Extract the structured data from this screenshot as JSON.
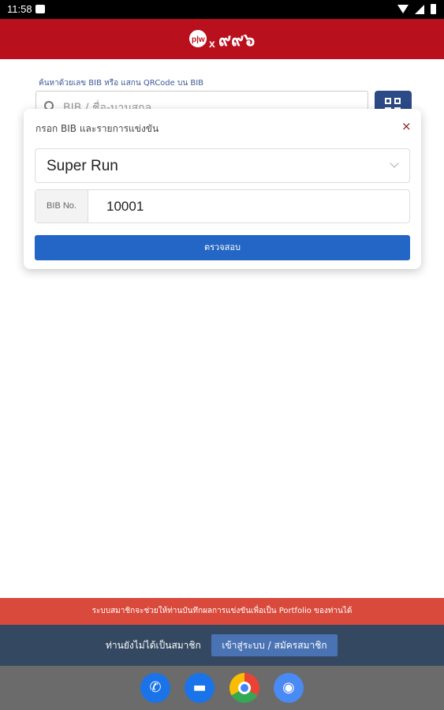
{
  "status_bar": {
    "time": "11:58"
  },
  "search": {
    "hint": "ค้นหาด้วยเลข BIB หรือ แสกน QRCode บน BIB",
    "placeholder": "BIB / ชื่อ-นามสกุล"
  },
  "modal": {
    "title": "กรอก BIB และรายการแข่งขัน",
    "close_label": "×",
    "race_selected": "Super Run",
    "bib_label": "BIB No.",
    "bib_value": "10001",
    "submit_label": "ตรวจสอบ"
  },
  "footer": {
    "promo_text": "ระบบสมาชิกจะช่วยให้ท่านบันทึกผลการแข่งขันเพื่อเป็น Portfolio ของท่านได้",
    "member_text": "ท่านยังไม่ได้เป็นสมาชิก",
    "login_button": "เข้าสู่ระบบ / สมัครสมาชิก"
  },
  "dock": {
    "apps": [
      "phone-icon",
      "messages-icon",
      "chrome-icon",
      "camera-icon"
    ]
  },
  "colors": {
    "header": "#b8101c",
    "primary_button": "#2366c5",
    "promo_bar": "#d94a3c",
    "member_bar": "#344861",
    "qr_button": "#2c4a86"
  }
}
